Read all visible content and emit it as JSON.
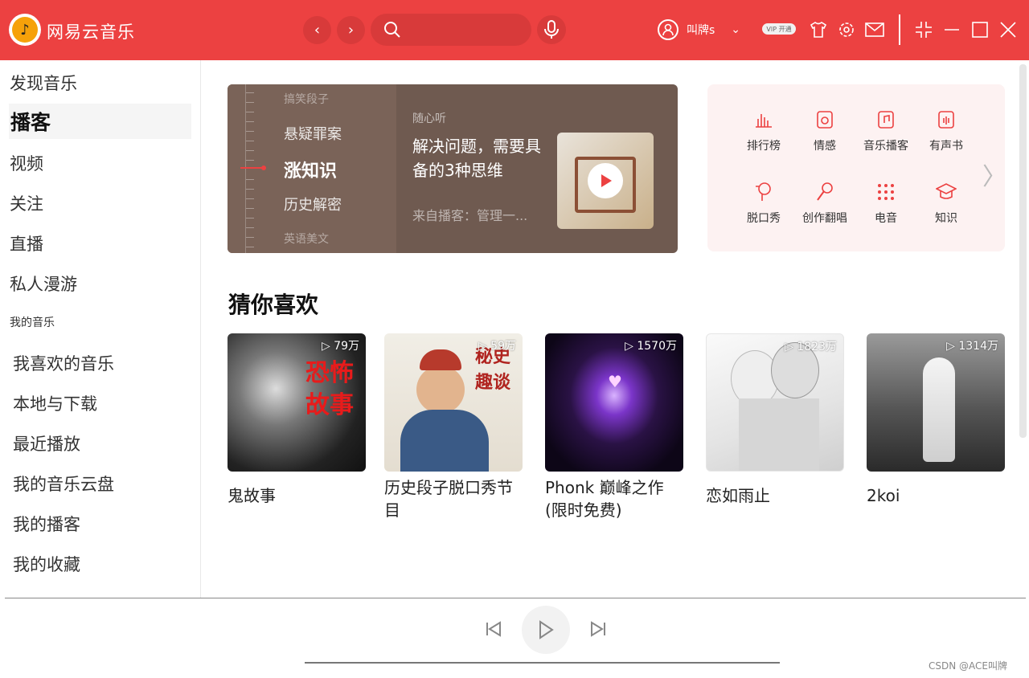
{
  "header": {
    "app_title": "网易云音乐",
    "search_placeholder": "",
    "username": "叫牌s",
    "vip_label": "VIP 开通",
    "accent": "#ec4141"
  },
  "sidebar": {
    "items": [
      "发现音乐",
      "播客",
      "视频",
      "关注",
      "直播",
      "私人漫游"
    ],
    "active_index": 1,
    "section_label": "我的音乐",
    "my_items": [
      "我喜欢的音乐",
      "本地与下载",
      "最近播放",
      "我的音乐云盘",
      "我的播客",
      "我的收藏"
    ]
  },
  "banner": {
    "categories": [
      "搞笑段子",
      "悬疑罪案",
      "涨知识",
      "历史解密",
      "英语美文"
    ],
    "active_category": "涨知识",
    "kicker": "随心听",
    "title": "解决问题，需要具备的3种思维",
    "from": "来自播客：管理一..."
  },
  "category_panel": {
    "items": [
      {
        "label": "排行榜",
        "icon": "chart-icon"
      },
      {
        "label": "情感",
        "icon": "heart-note-icon"
      },
      {
        "label": "音乐播客",
        "icon": "music-note-icon"
      },
      {
        "label": "有声书",
        "icon": "audiobook-icon"
      },
      {
        "label": "脱口秀",
        "icon": "microphone-head-icon"
      },
      {
        "label": "创作翻唱",
        "icon": "mic-icon"
      },
      {
        "label": "电音",
        "icon": "dots-grid-icon"
      },
      {
        "label": "知识",
        "icon": "graduation-cap-icon"
      }
    ]
  },
  "recommend": {
    "title": "猜你喜欢",
    "cards": [
      {
        "title": "鬼故事",
        "plays": "79万",
        "cover_text": "恐怖 故事"
      },
      {
        "title": "历史段子脱口秀节目",
        "plays": "59万",
        "cover_text": "秘史 趣谈"
      },
      {
        "title": "Phonk 巅峰之作(限时免费)",
        "plays": "1570万",
        "cover_text": ""
      },
      {
        "title": "恋如雨止",
        "plays": "1823万",
        "cover_text": ""
      },
      {
        "title": "2koi",
        "plays": "1314万",
        "cover_text": ""
      }
    ]
  },
  "watermark": "CSDN @ACE叫牌"
}
